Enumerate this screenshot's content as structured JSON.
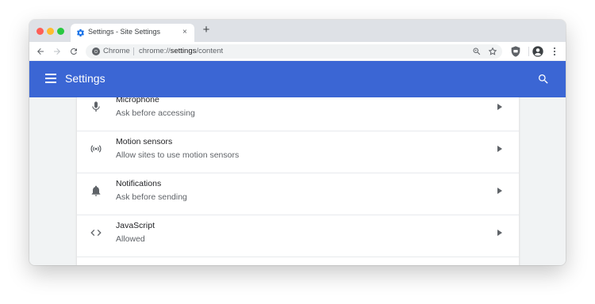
{
  "browser": {
    "tab_title": "Settings - Site Settings",
    "tab_close": "×",
    "new_tab": "+",
    "omnibox_chip": "Chrome",
    "url_prefix": "chrome://",
    "url_path": "settings",
    "url_suffix": "/content"
  },
  "header": {
    "title": "Settings",
    "color": "#3b66d4"
  },
  "rows": [
    {
      "title": "Microphone",
      "subtitle": "Ask before accessing",
      "icon": "microphone-icon"
    },
    {
      "title": "Motion sensors",
      "subtitle": "Allow sites to use motion sensors",
      "icon": "motion-sensors-icon"
    },
    {
      "title": "Notifications",
      "subtitle": "Ask before sending",
      "icon": "bell-icon"
    },
    {
      "title": "JavaScript",
      "subtitle": "Allowed",
      "icon": "code-icon"
    }
  ]
}
